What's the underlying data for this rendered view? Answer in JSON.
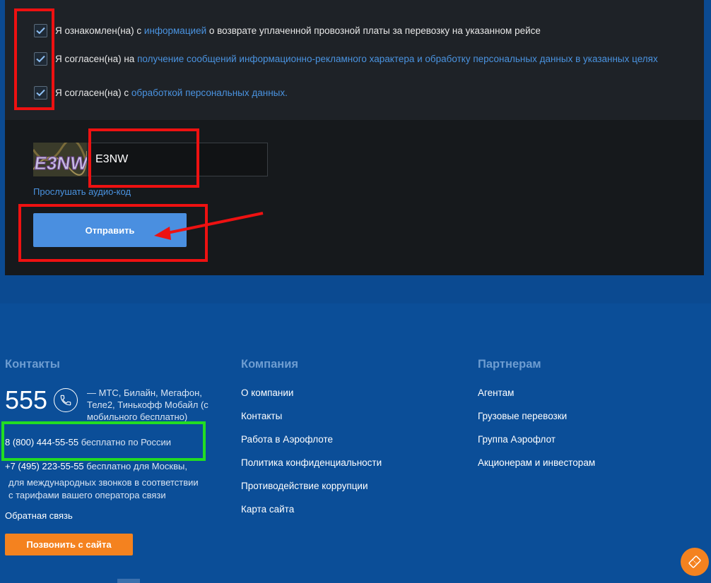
{
  "consents": [
    {
      "prefix": "Я ознакомлен(на) с ",
      "link": "информацией",
      "suffix": " о возврате уплаченной провозной платы за перевозку на указанном рейсе",
      "checked": true
    },
    {
      "prefix": "Я согласен(на) на ",
      "link": "получение сообщений информационно-рекламного характера и обработку персональных данных в указанных целях",
      "suffix": "",
      "checked": true
    },
    {
      "prefix": "Я согласен(на) с ",
      "link": "обработкой персональных данных.",
      "suffix": "",
      "checked": true
    }
  ],
  "captcha": {
    "image_text": "E3NW",
    "input_value": "E3NW",
    "audio_link": "Прослушать аудио-код"
  },
  "submit_label": "Отправить",
  "footer": {
    "contacts": {
      "heading": "Контакты",
      "short_number": "555",
      "operators_text": "— МТС, Билайн, Мегафон, Теле2, Тинькофф Мобайл (с мобильного бесплатно)",
      "line1_number": "8 (800) 444-55-55",
      "line1_note": "бесплатно по России",
      "line2_number": "+7 (495) 223-55-55",
      "line2_note": "бесплатно для Москвы,",
      "line3": "для международных звонков в соответствии",
      "line4": "с тарифами вашего оператора связи",
      "feedback": "Обратная связь",
      "call_button": "Позвонить с сайта"
    },
    "company": {
      "heading": "Компания",
      "links": [
        "О компании",
        "Контакты",
        "Работа в Аэрофлоте",
        "Политика конфиденциальности",
        "Противодействие коррупции",
        "Карта сайта"
      ]
    },
    "partners": {
      "heading": "Партнерам",
      "links": [
        "Агентам",
        "Грузовые перевозки",
        "Группа Аэрофлот",
        "Акционерам и инвесторам"
      ]
    }
  },
  "colors": {
    "accent_blue": "#4a8fe0",
    "orange": "#f4821f",
    "highlight_red": "#ee1111",
    "highlight_green": "#22dd22",
    "footer_bg": "#0b4e98"
  }
}
